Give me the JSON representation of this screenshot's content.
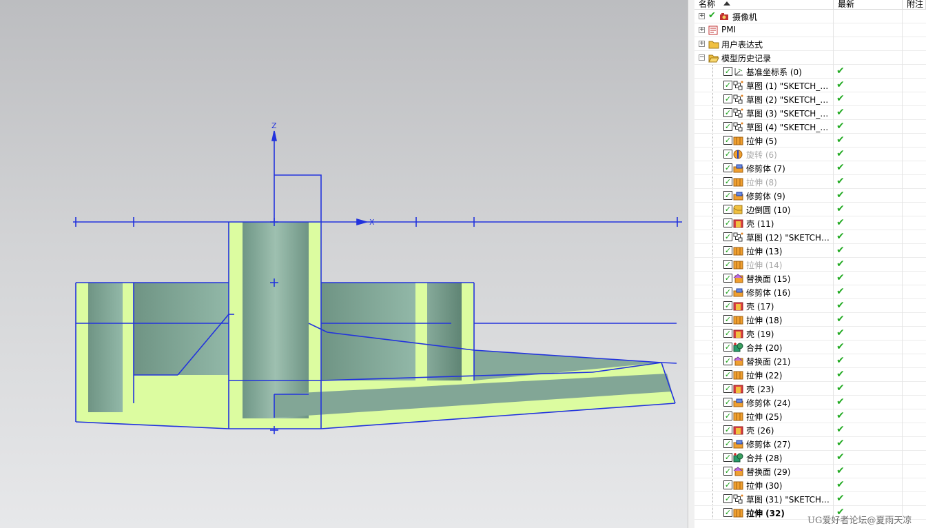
{
  "navigator": {
    "columns": {
      "name": "名称",
      "latest": "最新",
      "note": "附注"
    },
    "top_nodes": [
      {
        "label": "摄像机",
        "icon": "camera-icon",
        "expander": "+"
      },
      {
        "label": "PMI",
        "icon": "pmi-icon",
        "expander": "+"
      },
      {
        "label": "用户表达式",
        "icon": "folder-icon",
        "expander": "+"
      },
      {
        "label": "模型历史记录",
        "icon": "folder-open-icon",
        "expander": "−"
      }
    ],
    "features": [
      {
        "label": "基准坐标系 (0)",
        "icon": "datum-csys-icon",
        "state": "normal"
      },
      {
        "label": "草图 (1) \"SKETCH_0...",
        "icon": "sketch-icon",
        "state": "normal"
      },
      {
        "label": "草图 (2) \"SKETCH_0...",
        "icon": "sketch-icon",
        "state": "normal"
      },
      {
        "label": "草图 (3) \"SKETCH_0...",
        "icon": "sketch-icon",
        "state": "normal"
      },
      {
        "label": "草图 (4) \"SKETCH_0...",
        "icon": "sketch-icon",
        "state": "normal"
      },
      {
        "label": "拉伸 (5)",
        "icon": "extrude-icon",
        "state": "normal"
      },
      {
        "label": "旋转 (6)",
        "icon": "revolve-icon",
        "state": "suppressed"
      },
      {
        "label": "修剪体 (7)",
        "icon": "trim-body-icon",
        "state": "normal"
      },
      {
        "label": "拉伸 (8)",
        "icon": "extrude-icon",
        "state": "suppressed"
      },
      {
        "label": "修剪体 (9)",
        "icon": "trim-body-icon",
        "state": "normal"
      },
      {
        "label": "边倒圆 (10)",
        "icon": "edge-blend-icon",
        "state": "normal"
      },
      {
        "label": "壳 (11)",
        "icon": "shell-icon",
        "state": "normal"
      },
      {
        "label": "草图 (12) \"SKETCH_...",
        "icon": "sketch-icon",
        "state": "normal"
      },
      {
        "label": "拉伸 (13)",
        "icon": "extrude-icon",
        "state": "normal"
      },
      {
        "label": "拉伸 (14)",
        "icon": "extrude-icon",
        "state": "suppressed"
      },
      {
        "label": "替换面 (15)",
        "icon": "replace-face-icon",
        "state": "normal"
      },
      {
        "label": "修剪体 (16)",
        "icon": "trim-body-icon",
        "state": "normal"
      },
      {
        "label": "壳 (17)",
        "icon": "shell-icon",
        "state": "normal"
      },
      {
        "label": "拉伸 (18)",
        "icon": "extrude-icon",
        "state": "normal"
      },
      {
        "label": "壳 (19)",
        "icon": "shell-icon",
        "state": "normal"
      },
      {
        "label": "合并 (20)",
        "icon": "unite-icon",
        "state": "normal"
      },
      {
        "label": "替换面 (21)",
        "icon": "replace-face-icon",
        "state": "normal"
      },
      {
        "label": "拉伸 (22)",
        "icon": "extrude-icon",
        "state": "normal"
      },
      {
        "label": "壳 (23)",
        "icon": "shell-icon",
        "state": "normal"
      },
      {
        "label": "修剪体 (24)",
        "icon": "trim-body-icon",
        "state": "normal"
      },
      {
        "label": "拉伸 (25)",
        "icon": "extrude-icon",
        "state": "normal"
      },
      {
        "label": "壳 (26)",
        "icon": "shell-icon",
        "state": "normal"
      },
      {
        "label": "修剪体 (27)",
        "icon": "trim-body-icon",
        "state": "normal"
      },
      {
        "label": "合并 (28)",
        "icon": "unite-icon",
        "state": "normal"
      },
      {
        "label": "替换面 (29)",
        "icon": "replace-face-icon",
        "state": "normal"
      },
      {
        "label": "拉伸 (30)",
        "icon": "extrude-icon",
        "state": "normal"
      },
      {
        "label": "草图 (31) \"SKETCH_...",
        "icon": "sketch-icon",
        "state": "normal"
      },
      {
        "label": "拉伸 (32)",
        "icon": "extrude-icon",
        "state": "current"
      }
    ],
    "check_mark": "✔",
    "checkbox_mark": "✓"
  },
  "viewport": {
    "axis_z_label": "Z",
    "axis_x_label": "X"
  },
  "watermark": "UG爱好者论坛@夏雨天凉",
  "colors": {
    "sketch_blue": "#2233dd",
    "body_yellow": "#dcfca0",
    "cut_face_green": "#7fa898",
    "latest_green": "#22aa22"
  }
}
